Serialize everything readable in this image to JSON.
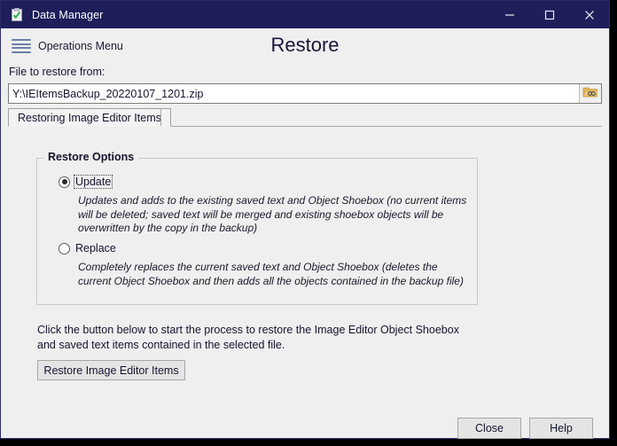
{
  "window": {
    "title": "Data Manager",
    "app_icon": "clipboard-check-icon",
    "controls": {
      "minimize": "minimize-icon",
      "maximize": "maximize-icon",
      "close": "close-icon"
    },
    "colors": {
      "titlebar": "#1e1e5a",
      "background": "#efefef",
      "border": "#2a2a6a",
      "hamburger": "#6b7fa8",
      "folder_icon": "#e8b95a"
    }
  },
  "header": {
    "operations_menu_label": "Operations Menu",
    "page_title": "Restore"
  },
  "file_field": {
    "label": "File to restore from:",
    "value": "Y:\\IEItemsBackup_20220107_1201.zip",
    "placeholder": "",
    "browse_icon": "folder-browse-icon"
  },
  "tabs": [
    {
      "label": "Restoring Image Editor Items",
      "selected": true
    }
  ],
  "restore_options": {
    "group_title": "Restore Options",
    "options": [
      {
        "label": "Update",
        "selected": true,
        "focused": true,
        "description": "Updates and adds to the existing saved text and Object Shoebox (no current items will be deleted; saved text will be merged and existing shoebox objects will be overwritten by the copy in the backup)"
      },
      {
        "label": "Replace",
        "selected": false,
        "focused": false,
        "description": "Completely replaces the current saved text and Object Shoebox (deletes the current Object Shoebox and then adds all the objects contained in the backup file)"
      }
    ]
  },
  "instruction": "Click the button below to start the process to restore the Image Editor Object Shoebox and saved text items contained in the selected file.",
  "action_button": "Restore Image Editor Items",
  "footer": {
    "close_label": "Close",
    "help_label": "Help"
  }
}
